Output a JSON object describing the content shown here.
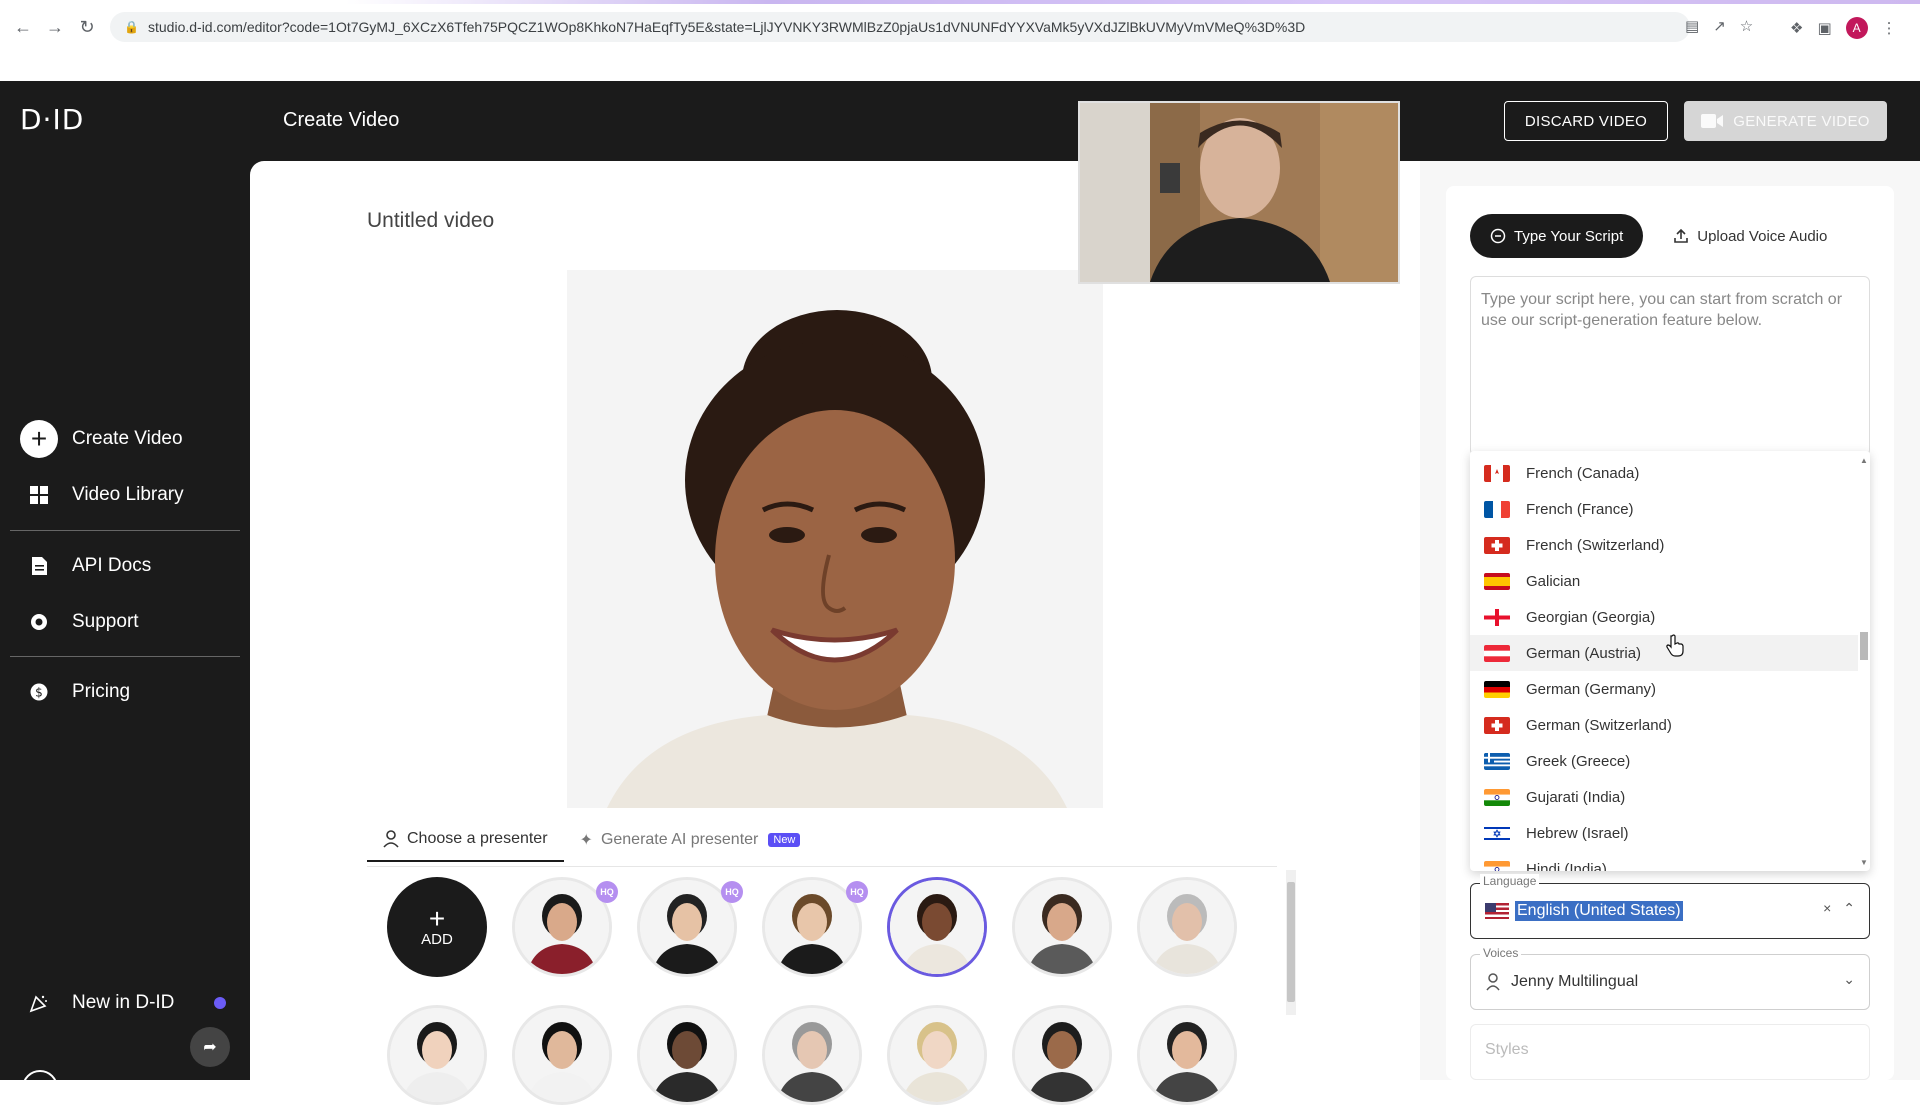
{
  "browser": {
    "url": "studio.d-id.com/editor?code=1Ot7GyMJ_6XCzX6Tfeh75PQCZ1WOp8KhkoN7HaEqfTy5E&state=LjlJYVNKY3RWMlBzZ0pjaUs1dVNUNFdYYXVaMk5yVXdJZlBkUVMyVmVMeQ%3D%3D",
    "profile_initial": "A"
  },
  "header": {
    "logo": "D·ID",
    "title": "Create Video",
    "discard_label": "DISCARD VIDEO",
    "generate_label": "GENERATE VIDEO"
  },
  "sidebar": {
    "items": [
      {
        "label": "Create Video",
        "icon": "plus-circle-icon"
      },
      {
        "label": "Video Library",
        "icon": "grid-icon"
      },
      {
        "label": "API Docs",
        "icon": "document-icon"
      },
      {
        "label": "Support",
        "icon": "lifebuoy-icon"
      },
      {
        "label": "Pricing",
        "icon": "dollar-icon"
      },
      {
        "label": "New in D-ID",
        "icon": "party-icon"
      }
    ]
  },
  "main": {
    "video_title": "Untitled video",
    "tabs": [
      {
        "label": "Choose a presenter"
      },
      {
        "label": "Generate AI presenter",
        "badge": "New"
      }
    ],
    "add_label": "ADD",
    "hq_badge": "HQ"
  },
  "right_panel": {
    "script_tab": "Type Your Script",
    "audio_tab": "Upload Voice Audio",
    "script_placeholder": "Type your script here, you can start from scratch or use our script-generation feature below.",
    "languages": [
      {
        "label": "French (Canada)",
        "flag": "ca"
      },
      {
        "label": "French (France)",
        "flag": "fr"
      },
      {
        "label": "French (Switzerland)",
        "flag": "ch"
      },
      {
        "label": "Galician",
        "flag": "es"
      },
      {
        "label": "Georgian (Georgia)",
        "flag": "ge"
      },
      {
        "label": "German (Austria)",
        "flag": "at"
      },
      {
        "label": "German (Germany)",
        "flag": "de"
      },
      {
        "label": "German (Switzerland)",
        "flag": "ch"
      },
      {
        "label": "Greek (Greece)",
        "flag": "gr"
      },
      {
        "label": "Gujarati (India)",
        "flag": "in"
      },
      {
        "label": "Hebrew (Israel)",
        "flag": "il"
      },
      {
        "label": "Hindi (India)",
        "flag": "in"
      }
    ],
    "language_label": "Language",
    "language_value": "English (United States)",
    "voices_label": "Voices",
    "voice_value": "Jenny Multilingual",
    "styles_placeholder": "Styles"
  }
}
